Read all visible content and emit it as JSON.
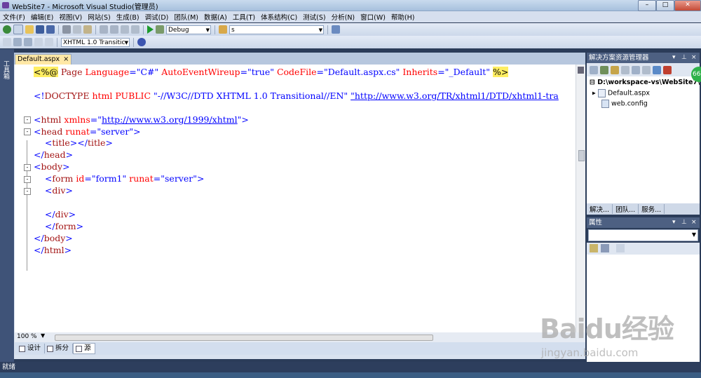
{
  "window": {
    "title": "WebSite7 - Microsoft Visual Studio(管理员)"
  },
  "menu": [
    "文件(F)",
    "编辑(E)",
    "视图(V)",
    "网站(S)",
    "生成(B)",
    "调试(D)",
    "团队(M)",
    "数据(A)",
    "工具(T)",
    "体系结构(C)",
    "测试(S)",
    "分析(N)",
    "窗口(W)",
    "帮助(H)"
  ],
  "toolbar": {
    "config": "Debug",
    "find_value": "s",
    "doctype_select": "XHTML 1.0 Transitic"
  },
  "toolbox": {
    "label": "工具箱"
  },
  "editor": {
    "tab_label": "Default.aspx",
    "tab_close": "×",
    "lines": [
      {
        "parts": [
          [
            "<%@",
            "dir"
          ],
          [
            " Page ",
            "maroon"
          ],
          [
            "Language",
            "red"
          ],
          [
            "=\"C#\" ",
            "blue"
          ],
          [
            "AutoEventWireup",
            "red"
          ],
          [
            "=\"true\" ",
            "blue"
          ],
          [
            "CodeFile",
            "red"
          ],
          [
            "=\"Default.aspx.cs\" ",
            "blue"
          ],
          [
            "Inherits",
            "red"
          ],
          [
            "=\"_Default\" ",
            "blue"
          ],
          [
            "%>",
            "dir"
          ]
        ]
      },
      {
        "parts": []
      },
      {
        "parts": [
          [
            "<!",
            "blue"
          ],
          [
            "DOCTYPE",
            "maroon"
          ],
          [
            " html ",
            "red"
          ],
          [
            "PUBLIC ",
            "red"
          ],
          [
            "\"-//W3C//DTD XHTML 1.0 Transitional//EN\" ",
            "blue"
          ],
          [
            "\"http://www.w3.org/TR/xhtml1/DTD/xhtml1-tra",
            "link"
          ]
        ]
      },
      {
        "parts": []
      },
      {
        "parts": [
          [
            "<",
            "blue"
          ],
          [
            "html",
            "maroon"
          ],
          [
            " xmlns",
            "red"
          ],
          [
            "=\"",
            "blue"
          ],
          [
            "http://www.w3.org/1999/xhtml",
            "link"
          ],
          [
            "\">",
            "blue"
          ]
        ]
      },
      {
        "parts": [
          [
            "<",
            "blue"
          ],
          [
            "head",
            "maroon"
          ],
          [
            " runat",
            "red"
          ],
          [
            "=\"server\">",
            "blue"
          ]
        ]
      },
      {
        "parts": [
          [
            "    <",
            "blue"
          ],
          [
            "title",
            "maroon"
          ],
          [
            "></",
            "blue"
          ],
          [
            "title",
            "maroon"
          ],
          [
            ">",
            "blue"
          ]
        ]
      },
      {
        "parts": [
          [
            "</",
            "blue"
          ],
          [
            "head",
            "maroon"
          ],
          [
            ">",
            "blue"
          ]
        ]
      },
      {
        "parts": [
          [
            "<",
            "blue"
          ],
          [
            "body",
            "maroon"
          ],
          [
            ">",
            "blue"
          ]
        ]
      },
      {
        "parts": [
          [
            "    <",
            "blue"
          ],
          [
            "form",
            "maroon"
          ],
          [
            " id",
            "red"
          ],
          [
            "=\"form1\" ",
            "blue"
          ],
          [
            "runat",
            "red"
          ],
          [
            "=\"server\">",
            "blue"
          ]
        ]
      },
      {
        "parts": [
          [
            "    <",
            "blue"
          ],
          [
            "div",
            "maroon"
          ],
          [
            ">",
            "blue"
          ]
        ]
      },
      {
        "parts": []
      },
      {
        "parts": [
          [
            "    </",
            "blue"
          ],
          [
            "div",
            "maroon"
          ],
          [
            ">",
            "blue"
          ]
        ]
      },
      {
        "parts": [
          [
            "    </",
            "blue"
          ],
          [
            "form",
            "maroon"
          ],
          [
            ">",
            "blue"
          ]
        ]
      },
      {
        "parts": [
          [
            "</",
            "blue"
          ],
          [
            "body",
            "maroon"
          ],
          [
            ">",
            "blue"
          ]
        ]
      },
      {
        "parts": [
          [
            "</",
            "blue"
          ],
          [
            "html",
            "maroon"
          ],
          [
            ">",
            "blue"
          ]
        ]
      }
    ],
    "zoom": "100 %",
    "view_tabs": [
      "设计",
      "拆分",
      "源"
    ]
  },
  "solution_explorer": {
    "title": "解决方案资源管理器",
    "root": "D:\\workspace-vs\\WebSite7\\",
    "items": [
      "Default.aspx",
      "web.config"
    ],
    "bottom_tabs": [
      "解决...",
      "团队...",
      "服务..."
    ]
  },
  "properties": {
    "title": "属性"
  },
  "status": {
    "text": "就绪"
  },
  "badge": {
    "text": "66"
  },
  "watermark": {
    "brand": "Baidu经验",
    "url": "jingyan.baidu.com"
  },
  "colors": {
    "accent": "#4d6082",
    "tab_active": "#ffe8a6",
    "directive_bg": "#ffee62"
  }
}
